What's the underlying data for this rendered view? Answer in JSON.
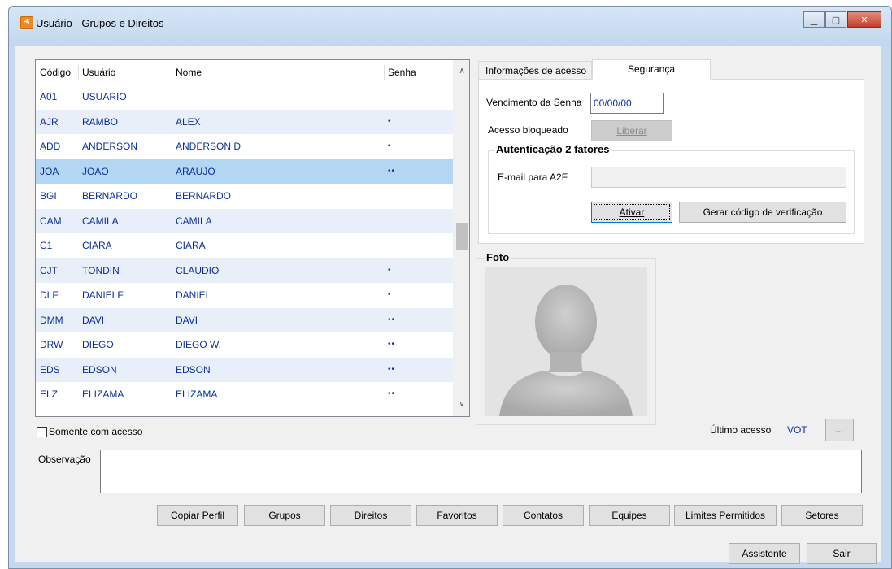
{
  "window": {
    "title": "Usuário - Grupos e Direitos",
    "app_icon": "app-logo-icon",
    "controls": [
      "minimize-icon",
      "maximize-icon",
      "close-icon"
    ]
  },
  "grid": {
    "columns": [
      "Código",
      "Usuário",
      "Nome",
      "Senha"
    ],
    "rows": [
      {
        "code": "A01",
        "user": "USUARIO",
        "name": "",
        "pass": ""
      },
      {
        "code": "AJR",
        "user": "RAMBO",
        "name": "ALEX",
        "pass": "•"
      },
      {
        "code": "ADD",
        "user": "ANDERSON",
        "name": "ANDERSON D",
        "pass": "•"
      },
      {
        "code": "JOA",
        "user": "JOAO",
        "name": "ARAUJO",
        "pass": "••"
      },
      {
        "code": "BGI",
        "user": "BERNARDO",
        "name": "BERNARDO",
        "pass": ""
      },
      {
        "code": "CAM",
        "user": "CAMILA",
        "name": "CAMILA",
        "pass": ""
      },
      {
        "code": "C1",
        "user": "CIARA",
        "name": "CIARA",
        "pass": ""
      },
      {
        "code": "CJT",
        "user": "TONDIN",
        "name": "CLAUDIO",
        "pass": "•"
      },
      {
        "code": "DLF",
        "user": "DANIELF",
        "name": "DANIEL",
        "pass": "•"
      },
      {
        "code": "DMM",
        "user": "DAVI",
        "name": "DAVI",
        "pass": "••"
      },
      {
        "code": "DRW",
        "user": "DIEGO",
        "name": "DIEGO W.",
        "pass": "••"
      },
      {
        "code": "EDS",
        "user": "EDSON",
        "name": "EDSON",
        "pass": "••"
      },
      {
        "code": "ELZ",
        "user": "ELIZAMA",
        "name": "ELIZAMA",
        "pass": "••"
      }
    ],
    "selected_index": 3
  },
  "filter": {
    "somente_com_acesso": "Somente com acesso"
  },
  "tabs": {
    "info": "Informações de acesso",
    "seguranca": "Segurança"
  },
  "security": {
    "vencimento_label": "Vencimento da Senha",
    "vencimento_value": "00/00/00",
    "bloqueado_label": "Acesso bloqueado",
    "liberar_btn": "Liberar",
    "a2f_title": "Autenticação 2 fatores",
    "email_label": "E-mail para A2F",
    "email_value": "",
    "ativar_btn": "Ativar",
    "gerar_btn": "Gerar código de verificação"
  },
  "photo": {
    "title": "Foto"
  },
  "ultimo_acesso": {
    "label": "Último acesso",
    "value": "VOT",
    "button": "..."
  },
  "observacao": {
    "label": "Observação",
    "value": ""
  },
  "buttons": {
    "copiar_perfil": "Copiar Perfil",
    "grupos": "Grupos",
    "direitos": "Direitos",
    "favoritos": "Favoritos",
    "contatos": "Contatos",
    "equipes": "Equipes",
    "limites": "Limites Permitidos",
    "setores": "Setores",
    "assistente": "Assistente",
    "sair": "Sair"
  }
}
